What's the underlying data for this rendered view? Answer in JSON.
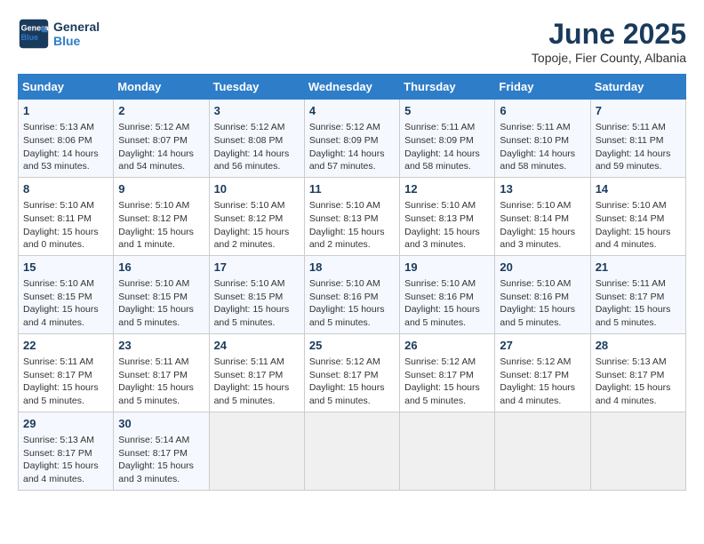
{
  "header": {
    "logo_line1": "General",
    "logo_line2": "Blue",
    "title": "June 2025",
    "subtitle": "Topoje, Fier County, Albania"
  },
  "columns": [
    "Sunday",
    "Monday",
    "Tuesday",
    "Wednesday",
    "Thursday",
    "Friday",
    "Saturday"
  ],
  "weeks": [
    [
      {
        "day": "1",
        "sunrise": "Sunrise: 5:13 AM",
        "sunset": "Sunset: 8:06 PM",
        "daylight": "Daylight: 14 hours and 53 minutes."
      },
      {
        "day": "2",
        "sunrise": "Sunrise: 5:12 AM",
        "sunset": "Sunset: 8:07 PM",
        "daylight": "Daylight: 14 hours and 54 minutes."
      },
      {
        "day": "3",
        "sunrise": "Sunrise: 5:12 AM",
        "sunset": "Sunset: 8:08 PM",
        "daylight": "Daylight: 14 hours and 56 minutes."
      },
      {
        "day": "4",
        "sunrise": "Sunrise: 5:12 AM",
        "sunset": "Sunset: 8:09 PM",
        "daylight": "Daylight: 14 hours and 57 minutes."
      },
      {
        "day": "5",
        "sunrise": "Sunrise: 5:11 AM",
        "sunset": "Sunset: 8:09 PM",
        "daylight": "Daylight: 14 hours and 58 minutes."
      },
      {
        "day": "6",
        "sunrise": "Sunrise: 5:11 AM",
        "sunset": "Sunset: 8:10 PM",
        "daylight": "Daylight: 14 hours and 58 minutes."
      },
      {
        "day": "7",
        "sunrise": "Sunrise: 5:11 AM",
        "sunset": "Sunset: 8:11 PM",
        "daylight": "Daylight: 14 hours and 59 minutes."
      }
    ],
    [
      {
        "day": "8",
        "sunrise": "Sunrise: 5:10 AM",
        "sunset": "Sunset: 8:11 PM",
        "daylight": "Daylight: 15 hours and 0 minutes."
      },
      {
        "day": "9",
        "sunrise": "Sunrise: 5:10 AM",
        "sunset": "Sunset: 8:12 PM",
        "daylight": "Daylight: 15 hours and 1 minute."
      },
      {
        "day": "10",
        "sunrise": "Sunrise: 5:10 AM",
        "sunset": "Sunset: 8:12 PM",
        "daylight": "Daylight: 15 hours and 2 minutes."
      },
      {
        "day": "11",
        "sunrise": "Sunrise: 5:10 AM",
        "sunset": "Sunset: 8:13 PM",
        "daylight": "Daylight: 15 hours and 2 minutes."
      },
      {
        "day": "12",
        "sunrise": "Sunrise: 5:10 AM",
        "sunset": "Sunset: 8:13 PM",
        "daylight": "Daylight: 15 hours and 3 minutes."
      },
      {
        "day": "13",
        "sunrise": "Sunrise: 5:10 AM",
        "sunset": "Sunset: 8:14 PM",
        "daylight": "Daylight: 15 hours and 3 minutes."
      },
      {
        "day": "14",
        "sunrise": "Sunrise: 5:10 AM",
        "sunset": "Sunset: 8:14 PM",
        "daylight": "Daylight: 15 hours and 4 minutes."
      }
    ],
    [
      {
        "day": "15",
        "sunrise": "Sunrise: 5:10 AM",
        "sunset": "Sunset: 8:15 PM",
        "daylight": "Daylight: 15 hours and 4 minutes."
      },
      {
        "day": "16",
        "sunrise": "Sunrise: 5:10 AM",
        "sunset": "Sunset: 8:15 PM",
        "daylight": "Daylight: 15 hours and 5 minutes."
      },
      {
        "day": "17",
        "sunrise": "Sunrise: 5:10 AM",
        "sunset": "Sunset: 8:15 PM",
        "daylight": "Daylight: 15 hours and 5 minutes."
      },
      {
        "day": "18",
        "sunrise": "Sunrise: 5:10 AM",
        "sunset": "Sunset: 8:16 PM",
        "daylight": "Daylight: 15 hours and 5 minutes."
      },
      {
        "day": "19",
        "sunrise": "Sunrise: 5:10 AM",
        "sunset": "Sunset: 8:16 PM",
        "daylight": "Daylight: 15 hours and 5 minutes."
      },
      {
        "day": "20",
        "sunrise": "Sunrise: 5:10 AM",
        "sunset": "Sunset: 8:16 PM",
        "daylight": "Daylight: 15 hours and 5 minutes."
      },
      {
        "day": "21",
        "sunrise": "Sunrise: 5:11 AM",
        "sunset": "Sunset: 8:17 PM",
        "daylight": "Daylight: 15 hours and 5 minutes."
      }
    ],
    [
      {
        "day": "22",
        "sunrise": "Sunrise: 5:11 AM",
        "sunset": "Sunset: 8:17 PM",
        "daylight": "Daylight: 15 hours and 5 minutes."
      },
      {
        "day": "23",
        "sunrise": "Sunrise: 5:11 AM",
        "sunset": "Sunset: 8:17 PM",
        "daylight": "Daylight: 15 hours and 5 minutes."
      },
      {
        "day": "24",
        "sunrise": "Sunrise: 5:11 AM",
        "sunset": "Sunset: 8:17 PM",
        "daylight": "Daylight: 15 hours and 5 minutes."
      },
      {
        "day": "25",
        "sunrise": "Sunrise: 5:12 AM",
        "sunset": "Sunset: 8:17 PM",
        "daylight": "Daylight: 15 hours and 5 minutes."
      },
      {
        "day": "26",
        "sunrise": "Sunrise: 5:12 AM",
        "sunset": "Sunset: 8:17 PM",
        "daylight": "Daylight: 15 hours and 5 minutes."
      },
      {
        "day": "27",
        "sunrise": "Sunrise: 5:12 AM",
        "sunset": "Sunset: 8:17 PM",
        "daylight": "Daylight: 15 hours and 4 minutes."
      },
      {
        "day": "28",
        "sunrise": "Sunrise: 5:13 AM",
        "sunset": "Sunset: 8:17 PM",
        "daylight": "Daylight: 15 hours and 4 minutes."
      }
    ],
    [
      {
        "day": "29",
        "sunrise": "Sunrise: 5:13 AM",
        "sunset": "Sunset: 8:17 PM",
        "daylight": "Daylight: 15 hours and 4 minutes."
      },
      {
        "day": "30",
        "sunrise": "Sunrise: 5:14 AM",
        "sunset": "Sunset: 8:17 PM",
        "daylight": "Daylight: 15 hours and 3 minutes."
      },
      null,
      null,
      null,
      null,
      null
    ]
  ]
}
